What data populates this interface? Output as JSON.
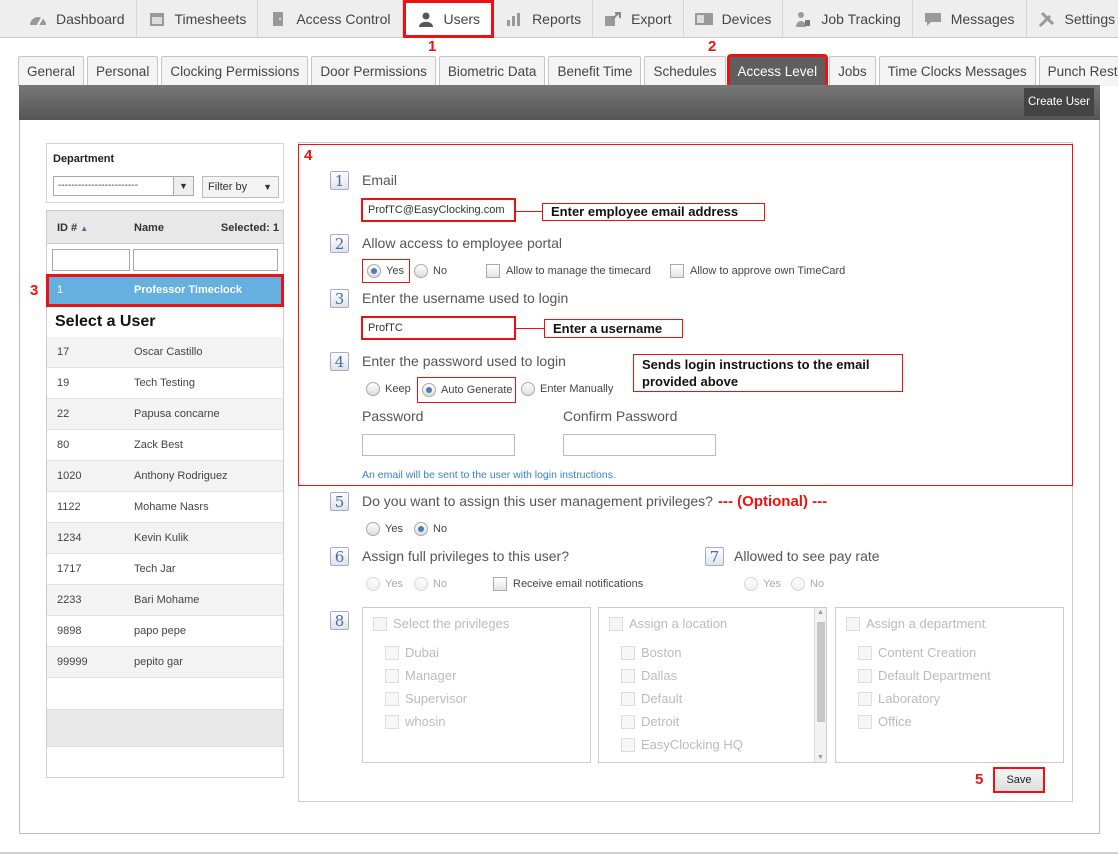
{
  "topnav": [
    {
      "label": "Dashboard",
      "icon": "dashboard-icon"
    },
    {
      "label": "Timesheets",
      "icon": "calendar-icon"
    },
    {
      "label": "Access Control",
      "icon": "door-icon"
    },
    {
      "label": "Users",
      "icon": "user-icon"
    },
    {
      "label": "Reports",
      "icon": "bar-chart-icon"
    },
    {
      "label": "Export",
      "icon": "export-icon"
    },
    {
      "label": "Devices",
      "icon": "devices-icon"
    },
    {
      "label": "Job Tracking",
      "icon": "job-tracking-icon"
    },
    {
      "label": "Messages",
      "icon": "message-icon"
    },
    {
      "label": "Settings",
      "icon": "tools-icon"
    }
  ],
  "subtabs": [
    "General",
    "Personal",
    "Clocking Permissions",
    "Door Permissions",
    "Biometric Data",
    "Benefit Time",
    "Schedules",
    "Access Level",
    "Jobs",
    "Time Clocks Messages",
    "Punch Restriction"
  ],
  "create_user": "Create User",
  "markers": {
    "m1": "1",
    "m2": "2",
    "m3": "3",
    "m4": "4",
    "m5": "5"
  },
  "department": {
    "label": "Department",
    "value": "------------------------",
    "filter": "Filter by"
  },
  "userlist": {
    "col_id": "ID #",
    "col_name": "Name",
    "selected": "Selected: 1",
    "selected_row": {
      "id": "1",
      "name": "Professor Timeclock"
    },
    "select_label": "Select a User",
    "rows": [
      {
        "id": "17",
        "name": "Oscar Castillo"
      },
      {
        "id": "19",
        "name": "Tech Testing"
      },
      {
        "id": "22",
        "name": "Papusa concarne"
      },
      {
        "id": "80",
        "name": "Zack Best"
      },
      {
        "id": "1020",
        "name": "Anthony Rodriguez"
      },
      {
        "id": "1122",
        "name": "Mohame Nasrs"
      },
      {
        "id": "1234",
        "name": "Kevin Kulik"
      },
      {
        "id": "1717",
        "name": "Tech Jar"
      },
      {
        "id": "2233",
        "name": "Bari Mohame"
      },
      {
        "id": "9898",
        "name": "papo pepe"
      },
      {
        "id": "99999",
        "name": "pepito gar"
      }
    ]
  },
  "form": {
    "s1": "1",
    "q1": "Email",
    "email": "ProfTC@EasyClocking.com",
    "note_email": "Enter employee email address",
    "s2": "2",
    "q2": "Allow access to employee portal",
    "yes": "Yes",
    "no": "No",
    "manage_timecard": "Allow to manage the timecard",
    "approve_timecard": "Allow to approve own TimeCard",
    "s3": "3",
    "q3": "Enter the username used to login",
    "username": "ProfTC",
    "note_username": "Enter a username",
    "s4": "4",
    "q4": "Enter the password used to login",
    "keep": "Keep",
    "auto": "Auto Generate",
    "manual": "Enter Manually",
    "note_password": "Sends login instructions to the email provided above",
    "password": "Password",
    "confirm": "Confirm Password",
    "email_note": "An email will be sent to the user with login instructions.",
    "s5": "5",
    "q5": "Do you want to assign this user management privileges?",
    "optional": "--- (Optional) ---",
    "s6": "6",
    "q6": "Assign full privileges to this user?",
    "receive": "Receive email notifications",
    "s7": "7",
    "q7": "Allowed to see pay rate",
    "s8": "8",
    "privileges": {
      "title": "Select the privileges",
      "items": [
        "Dubai",
        "Manager",
        "Supervisor",
        "whosin"
      ]
    },
    "locations": {
      "title": "Assign a location",
      "items": [
        "Boston",
        "Dallas",
        "Default",
        "Detroit",
        "EasyClocking HQ"
      ]
    },
    "departments": {
      "title": "Assign a department",
      "items": [
        "Content Creation",
        "Default Department",
        "Laboratory",
        "Office"
      ]
    },
    "save": "Save"
  }
}
